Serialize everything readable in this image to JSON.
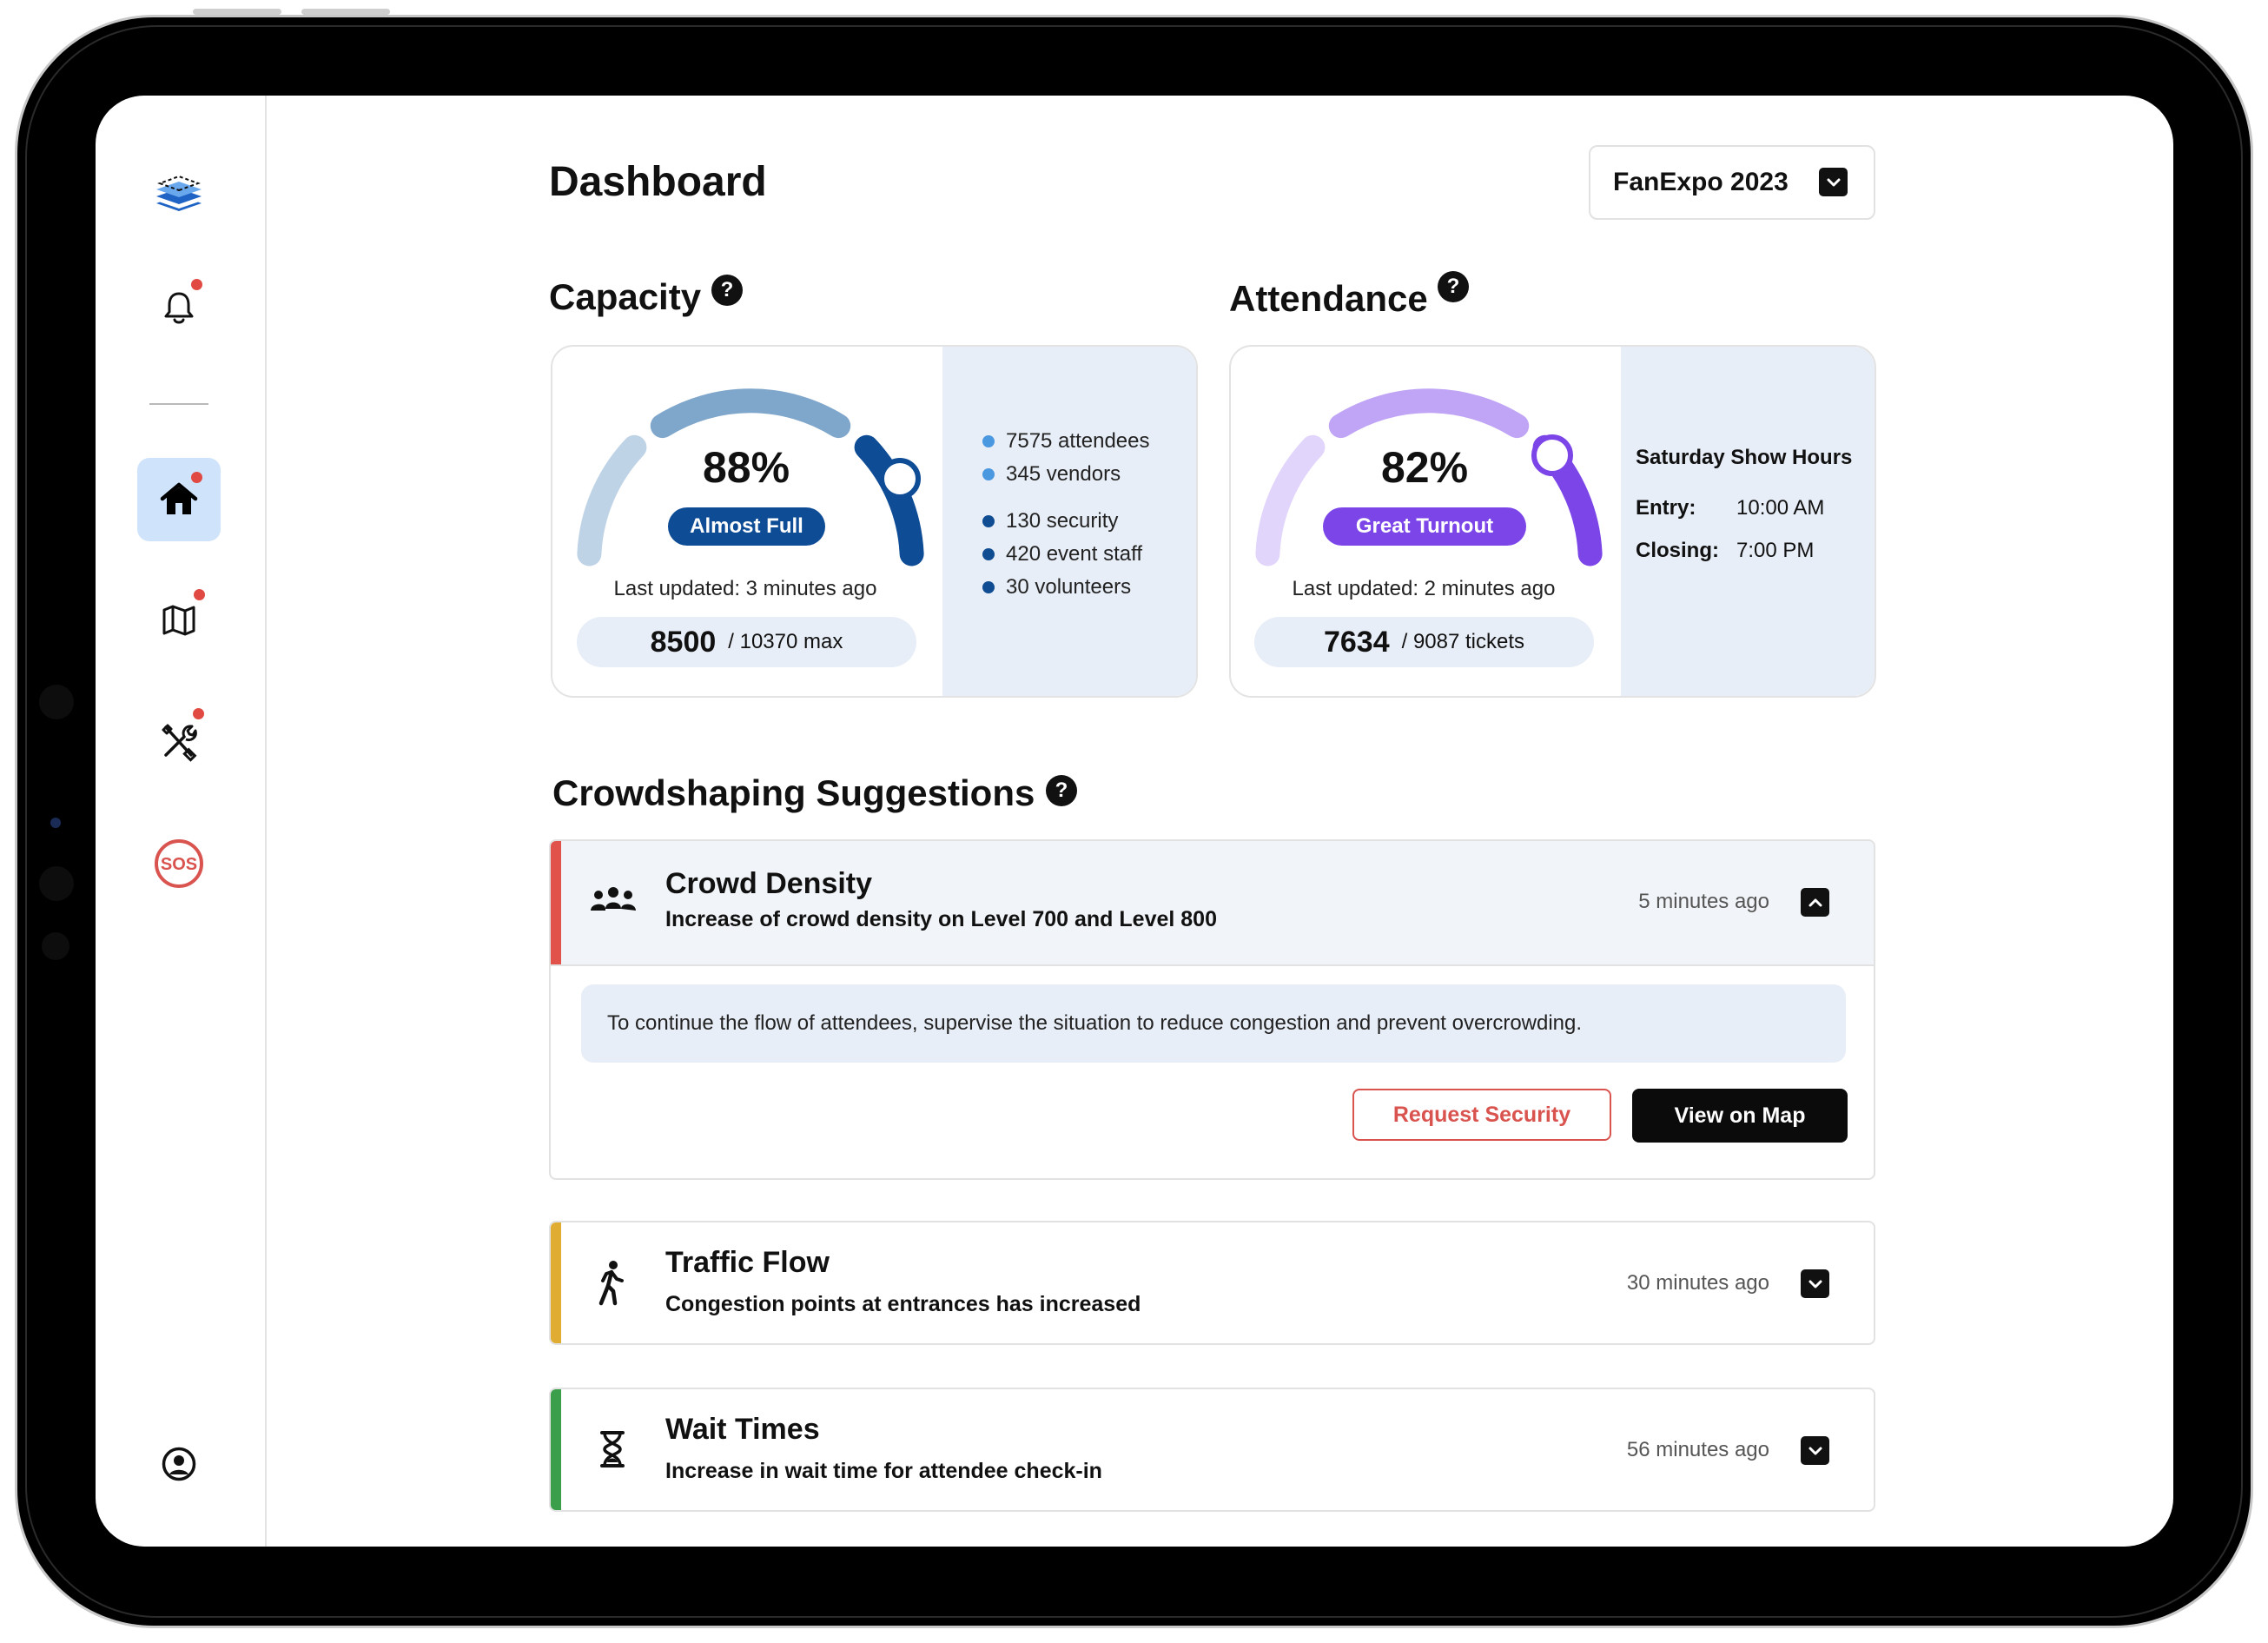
{
  "page": {
    "title": "Dashboard"
  },
  "event_selector": {
    "value": "FanExpo 2023",
    "icon": "chevron-down-icon"
  },
  "sidebar": {
    "items": [
      {
        "name": "logo",
        "icon": "layers-logo-icon"
      },
      {
        "name": "notifications",
        "icon": "bell-icon",
        "badge": true
      },
      {
        "name": "home",
        "icon": "home-icon",
        "badge": true,
        "active": true
      },
      {
        "name": "map",
        "icon": "map-icon",
        "badge": true
      },
      {
        "name": "tools",
        "icon": "tools-icon",
        "badge": true
      },
      {
        "name": "sos",
        "icon": "sos-icon",
        "label": "SOS"
      },
      {
        "name": "account",
        "icon": "user-circle-icon"
      }
    ]
  },
  "capacity": {
    "heading": "Capacity",
    "help": "?",
    "percent_label": "88%",
    "percent_value": 88,
    "status": "Almost Full",
    "updated": "Last updated: 3 minutes ago",
    "current": "8500",
    "max_label": "/ 10370 max",
    "breakdown": [
      {
        "text": "7575 attendees",
        "color": "#4a98e0"
      },
      {
        "text": "345 vendors",
        "color": "#4a98e0"
      },
      {
        "text": "130 security",
        "color": "#0f4c92"
      },
      {
        "text": "420 event staff",
        "color": "#0f4c92"
      },
      {
        "text": "30 volunteers",
        "color": "#0f4c92"
      }
    ],
    "colors": {
      "track_light": "#bfd3e6",
      "track_mid": "#7fa6cb",
      "track_dark": "#0e4c96",
      "pill": "#0e4c96"
    }
  },
  "attendance": {
    "heading": "Attendance",
    "help": "?",
    "percent_label": "82%",
    "percent_value": 82,
    "status": "Great Turnout",
    "updated": "Last updated: 2 minutes ago",
    "current": "7634",
    "max_label": "/ 9087 tickets",
    "hours": {
      "title": "Saturday Show Hours",
      "entry_label": "Entry:",
      "entry_value": "10:00 AM",
      "closing_label": "Closing:",
      "closing_value": "7:00 PM"
    },
    "colors": {
      "track_light": "#e2d5fb",
      "track_mid": "#c0a4f5",
      "track_dark": "#7c45e8",
      "pill": "#7c45e8"
    }
  },
  "suggestions": {
    "heading": "Crowdshaping Suggestions",
    "help": "?",
    "items": [
      {
        "title": "Crowd Density",
        "description": "Increase of crowd density on Level 700 and Level 800",
        "time": "5 minutes ago",
        "icon": "crowd-icon",
        "accent": "#e0524a",
        "expanded": true,
        "detail": "To continue the flow of attendees, supervise the situation to reduce congestion and prevent overcrowding.",
        "actions": {
          "secondary": "Request Security",
          "primary": "View on Map"
        }
      },
      {
        "title": "Traffic Flow",
        "description": "Congestion points at entrances has increased",
        "time": "30 minutes ago",
        "icon": "walking-person-icon",
        "accent": "#e0ac32",
        "expanded": false
      },
      {
        "title": "Wait Times",
        "description": "Increase in wait time for attendee check-in",
        "time": "56 minutes ago",
        "icon": "hourglass-icon",
        "accent": "#3a9e4a",
        "expanded": false
      }
    ]
  }
}
